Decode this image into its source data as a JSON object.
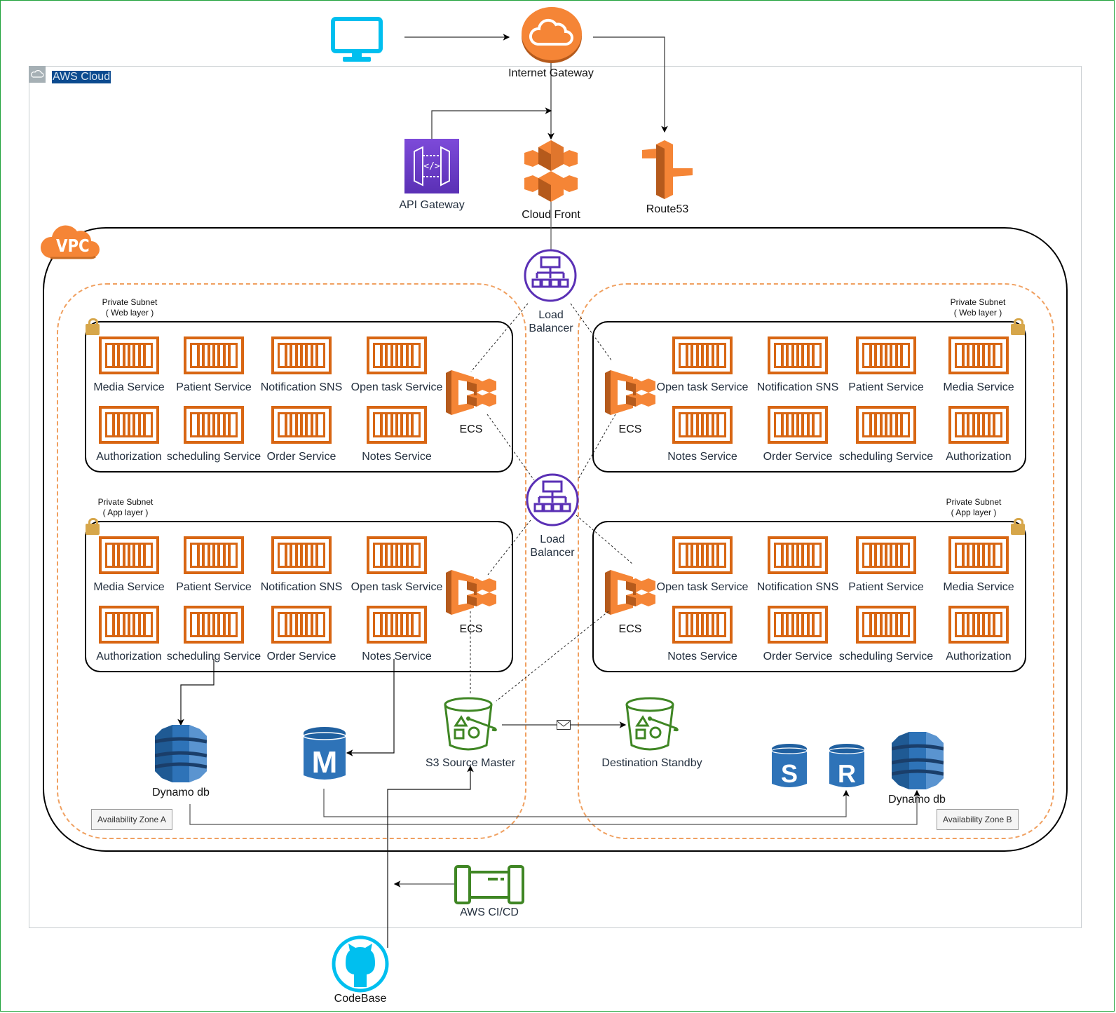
{
  "diagram": {
    "outer_frame_color": "#1fa23a",
    "aws_cloud": {
      "label": "AWS Cloud"
    },
    "vpc": {
      "label": "VPC"
    },
    "edge": {
      "client": {
        "icon": "desktop-monitor-icon"
      },
      "internet_gateway": {
        "label": "Internet Gateway",
        "icon": "internet-gateway-cloud-icon"
      },
      "api_gateway": {
        "label": "API Gateway",
        "icon": "api-gateway-icon"
      },
      "cloud_front": {
        "label": "Cloud Front",
        "icon": "cloudfront-icon"
      },
      "route53": {
        "label": "Route53",
        "icon": "route53-icon"
      }
    },
    "load_balancers": [
      {
        "label_line1": "Load",
        "label_line2": "Balancer"
      },
      {
        "label_line1": "Load",
        "label_line2": "Balancer"
      }
    ],
    "subnets": {
      "web_left": {
        "title_line1": "Private Subnet",
        "title_line2": "( Web layer )",
        "ecs_label": "ECS",
        "services": [
          "Media Service",
          "Patient Service",
          "Notification SNS",
          "Open task Service",
          "Authorization",
          "scheduling Service",
          "Order Service",
          "Notes Service"
        ]
      },
      "web_right": {
        "title_line1": "Private Subnet",
        "title_line2": "( Web layer )",
        "ecs_label": "ECS",
        "services": [
          "Open task Service",
          "Notification SNS",
          "Patient Service",
          "Media Service",
          "Notes Service",
          "Order Service",
          "scheduling Service",
          "Authorization"
        ]
      },
      "app_left": {
        "title_line1": "Private Subnet",
        "title_line2": "( App layer )",
        "ecs_label": "ECS",
        "services": [
          "Media Service",
          "Patient Service",
          "Notification SNS",
          "Open task Service",
          "Authorization",
          "scheduling Service",
          "Order Service",
          "Notes Service"
        ]
      },
      "app_right": {
        "title_line1": "Private Subnet",
        "title_line2": "( App layer )",
        "ecs_label": "ECS",
        "services": [
          "Open task Service",
          "Notification SNS",
          "Patient Service",
          "Media Service",
          "Notes Service",
          "Order Service",
          "scheduling Service",
          "Authorization"
        ]
      }
    },
    "storage": {
      "dynamo_a": {
        "label": "Dynamo db"
      },
      "rds_master": {
        "letter": "M"
      },
      "s3_source": {
        "label": "S3 Source Master"
      },
      "s3_destination": {
        "label": "Destination Standby"
      },
      "rds_standby": {
        "letter": "S"
      },
      "rds_replica": {
        "letter": "R"
      },
      "dynamo_b": {
        "label": "Dynamo db"
      }
    },
    "availability_zones": {
      "a": "Availability Zone A",
      "b": "Availability Zone B"
    },
    "ci_cd": {
      "label": "AWS CI/CD"
    },
    "codebase": {
      "label": "CodeBase"
    },
    "colors": {
      "orange": "#d86613",
      "aws_orange": "#f58536",
      "purple": "#5a30b5",
      "green": "#3f8624",
      "blue": "#2e73b8",
      "cyan": "#00bfef"
    }
  }
}
